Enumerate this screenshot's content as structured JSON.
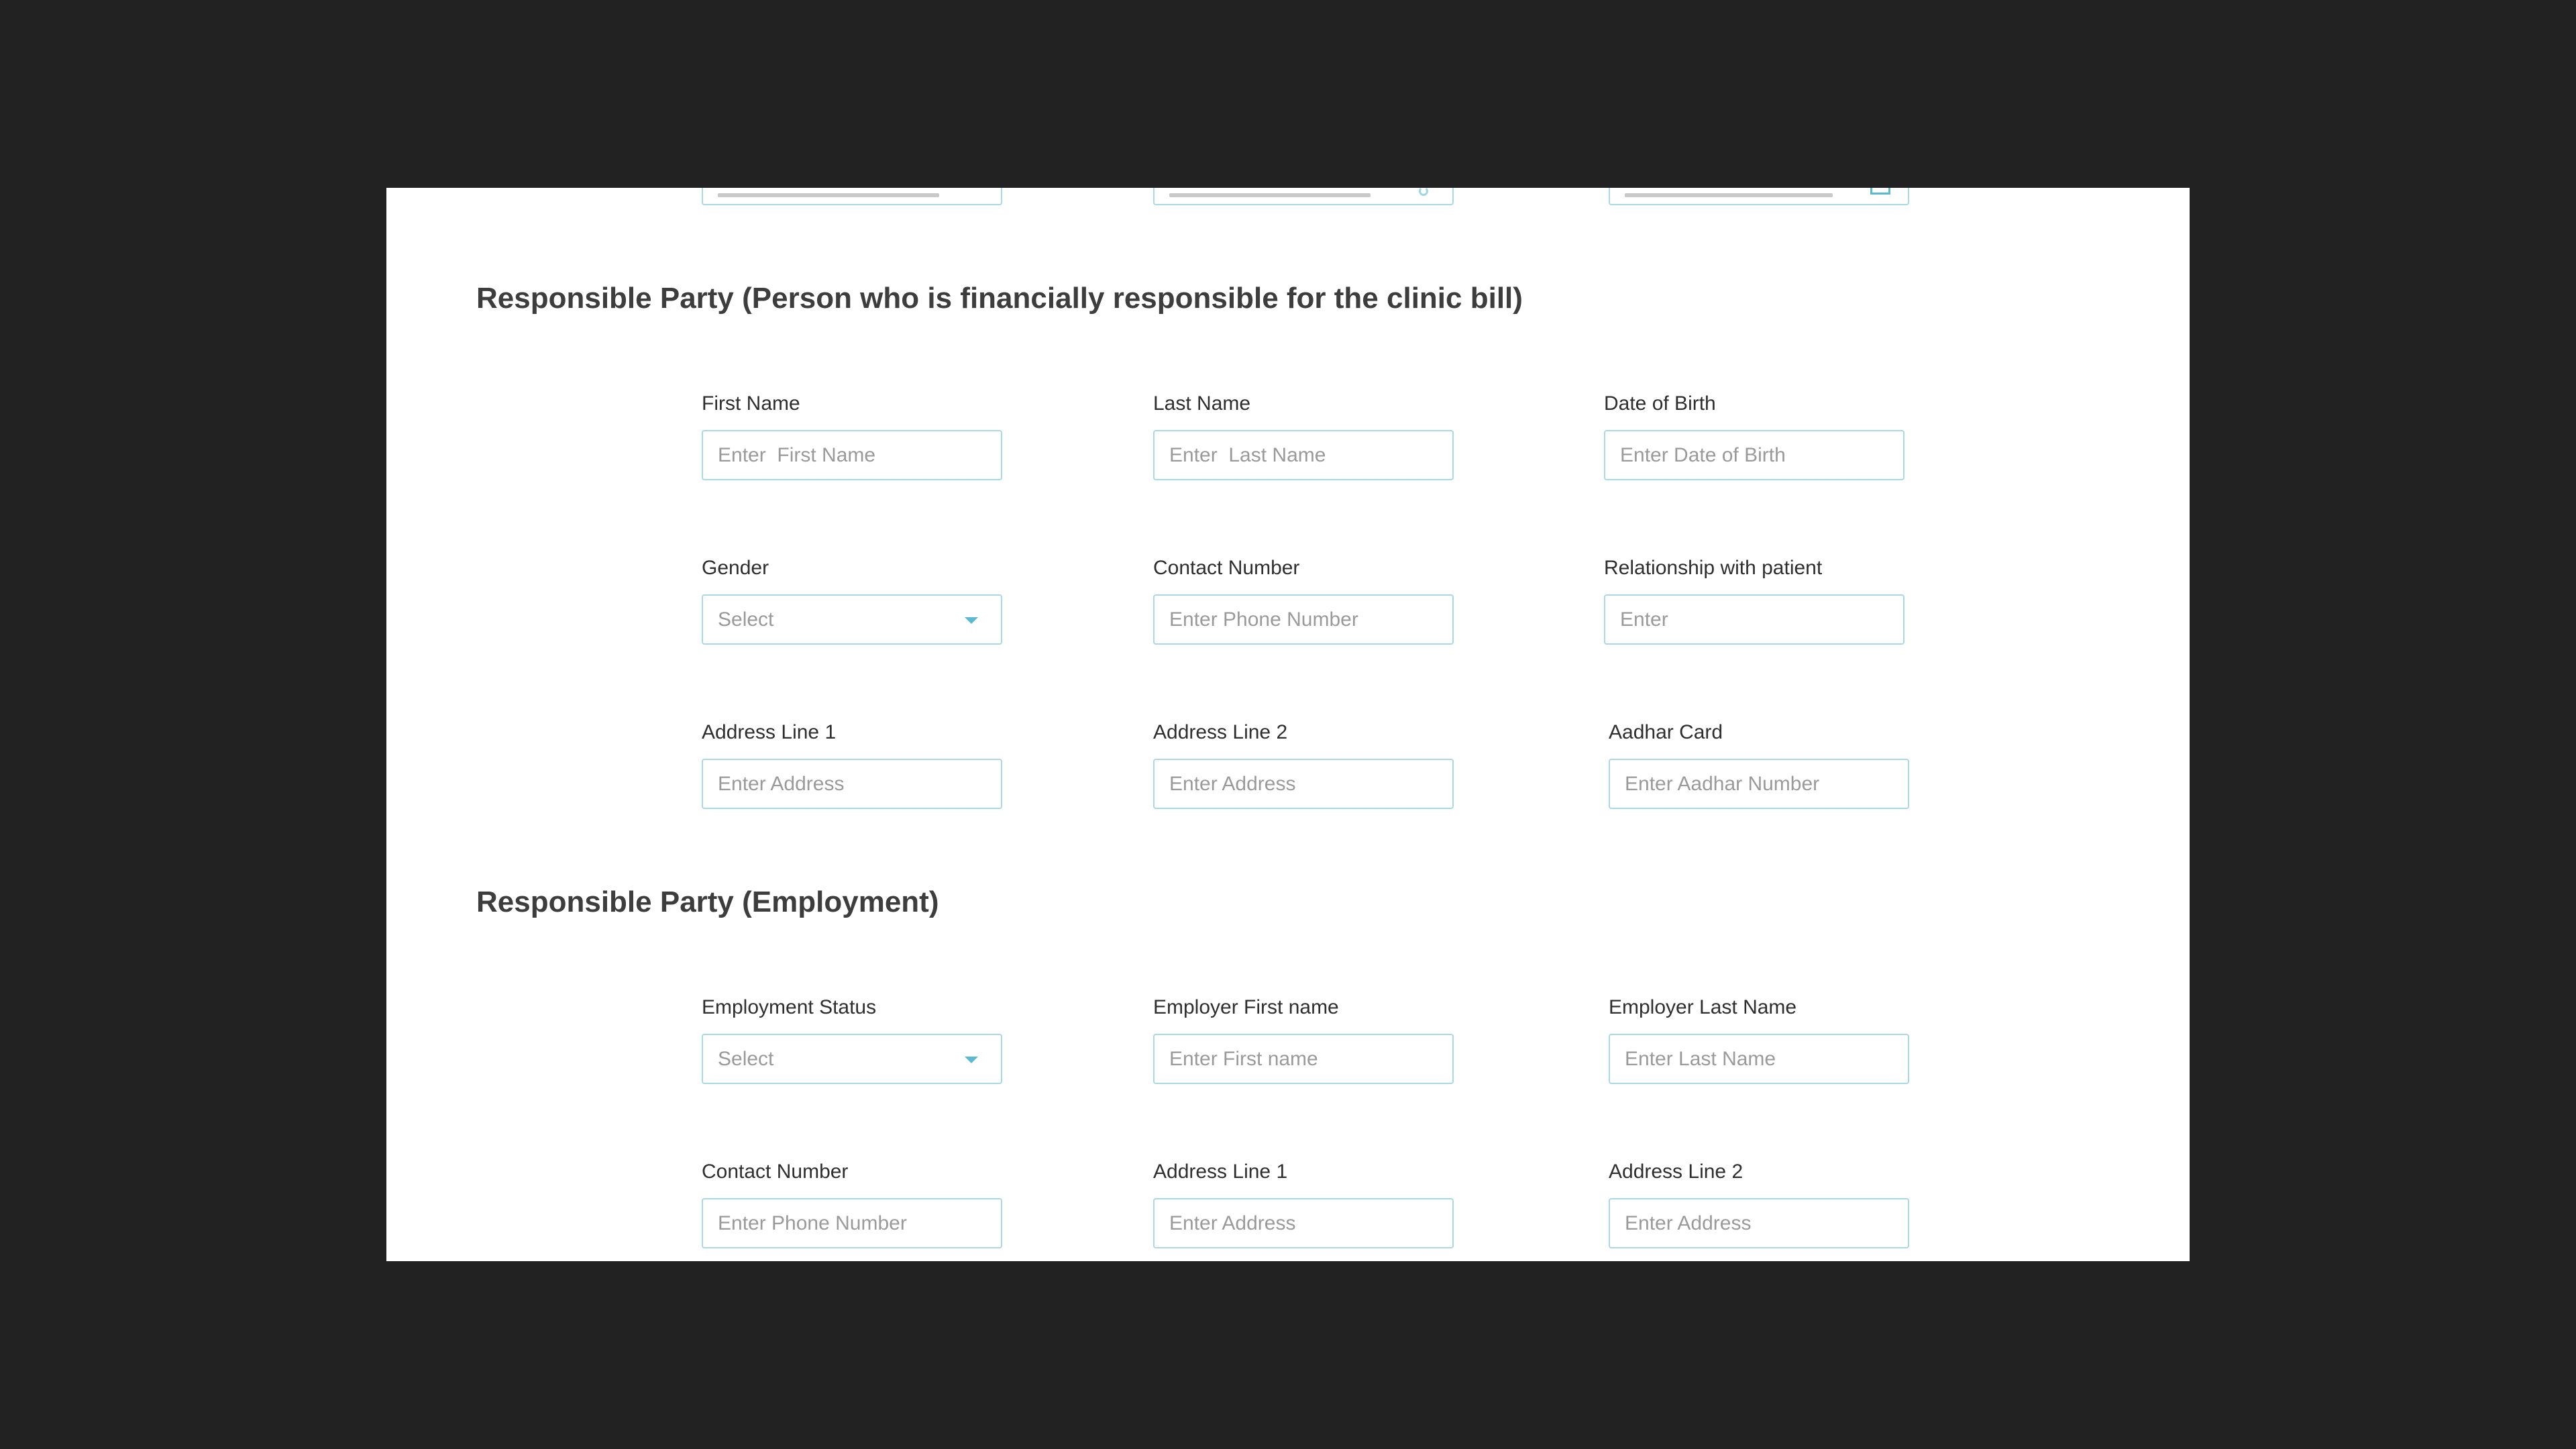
{
  "sections": {
    "responsible_party": {
      "title": "Responsible Party (Person who is financially responsible for the clinic bill)",
      "fields": {
        "first_name": {
          "label": "First Name",
          "placeholder": "Enter  First Name"
        },
        "last_name": {
          "label": "Last Name",
          "placeholder": "Enter  Last Name"
        },
        "date_of_birth": {
          "label": "Date of Birth",
          "placeholder": "Enter Date of Birth"
        },
        "gender": {
          "label": "Gender",
          "value": "Select",
          "icon": "chevron-down-icon"
        },
        "contact_number": {
          "label": "Contact Number",
          "placeholder": "Enter Phone Number"
        },
        "relationship": {
          "label": "Relationship with patient",
          "placeholder": "Enter"
        },
        "address_line_1": {
          "label": "Address Line 1",
          "placeholder": "Enter Address"
        },
        "address_line_2": {
          "label": "Address Line 2",
          "placeholder": "Enter Address"
        },
        "aadhar_card": {
          "label": "Aadhar Card",
          "placeholder": "Enter Aadhar Number"
        }
      }
    },
    "employment": {
      "title": "Responsible Party (Employment)",
      "fields": {
        "employment_status": {
          "label": "Employment Status",
          "value": "Select",
          "icon": "chevron-down-icon"
        },
        "employer_first_name": {
          "label": "Employer First name",
          "placeholder": "Enter First name"
        },
        "employer_last_name": {
          "label": "Employer Last Name",
          "placeholder": "Enter Last Name"
        },
        "contact_number": {
          "label": "Contact Number",
          "placeholder": "Enter Phone Number"
        },
        "address_line_1": {
          "label": "Address Line 1",
          "placeholder": "Enter Address"
        },
        "address_line_2": {
          "label": "Address Line 2",
          "placeholder": "Enter Address"
        }
      }
    }
  },
  "colors": {
    "backdrop": "#222222",
    "panel": "#ffffff",
    "input_border": "#a8d9e6",
    "accent": "#5bb9d2",
    "heading_text": "#3d3d3d",
    "label_text": "#2e2e2e",
    "placeholder_text": "#9a9a9a"
  }
}
